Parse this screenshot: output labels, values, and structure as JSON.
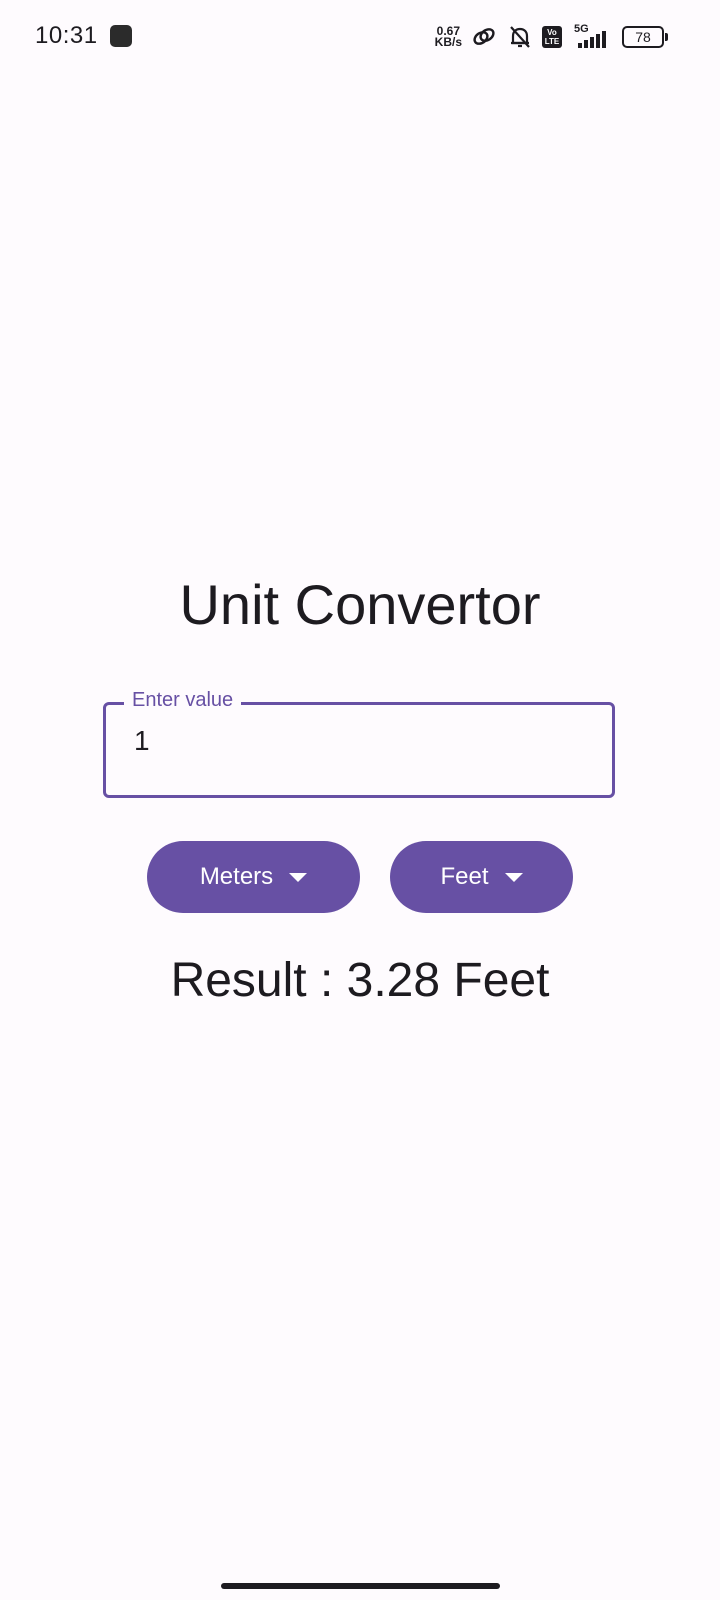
{
  "status_bar": {
    "time": "10:31",
    "net_speed_value": "0.67",
    "net_speed_unit": "KB/s",
    "volte_top": "Vo",
    "volte_bottom": "LTE",
    "network": "5G",
    "battery": "78",
    "icons": [
      "app-notification-icon",
      "link-icon",
      "bell-off-icon",
      "volte-icon",
      "signal-icon",
      "battery-icon"
    ]
  },
  "main": {
    "title": "Unit Convertor",
    "input": {
      "label": "Enter value",
      "value": "1"
    },
    "from_unit": "Meters",
    "to_unit": "Feet",
    "result": "Result : 3.28 Feet"
  },
  "colors": {
    "primary": "#6750a4",
    "background": "#fefbfe",
    "text": "#1d1b20"
  }
}
